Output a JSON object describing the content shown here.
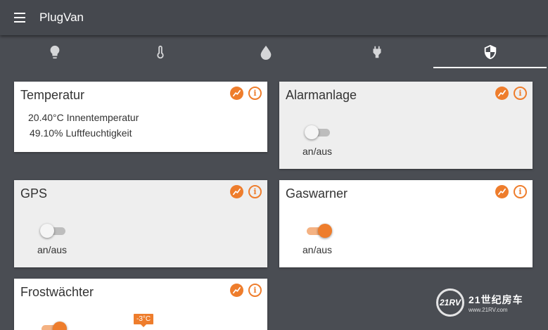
{
  "app": {
    "title": "PlugVan"
  },
  "tabs": [
    {
      "name": "light",
      "icon": "lightbulb-icon",
      "active": false
    },
    {
      "name": "temperature",
      "icon": "thermometer-icon",
      "active": false
    },
    {
      "name": "humidity",
      "icon": "water-drop-icon",
      "active": false
    },
    {
      "name": "power",
      "icon": "plug-icon",
      "active": false
    },
    {
      "name": "security",
      "icon": "shield-icon",
      "active": true
    }
  ],
  "colors": {
    "accent": "#ee7d2c",
    "background": "#4a4d53",
    "card": "#ffffff",
    "card_grey": "#eeeeee"
  },
  "cards": {
    "temperatur": {
      "title": "Temperatur",
      "readings": [
        {
          "value": "20.40°C",
          "label": "Innentemperatur"
        },
        {
          "value": "49.10%",
          "label": "Luftfeuchtigkeit"
        }
      ]
    },
    "alarmanlage": {
      "title": "Alarmanlage",
      "toggle_label": "an/aus",
      "on": false
    },
    "gps": {
      "title": "GPS",
      "toggle_label": "an/aus",
      "on": false
    },
    "gaswarner": {
      "title": "Gaswarner",
      "toggle_label": "an/aus",
      "on": true
    },
    "frostwaechter": {
      "title": "Frostwächter",
      "slider_value": "-3°C",
      "on": true
    }
  },
  "watermark": {
    "logo": "21RV",
    "main": "21世纪房车",
    "sub": "www.21RV.com"
  }
}
